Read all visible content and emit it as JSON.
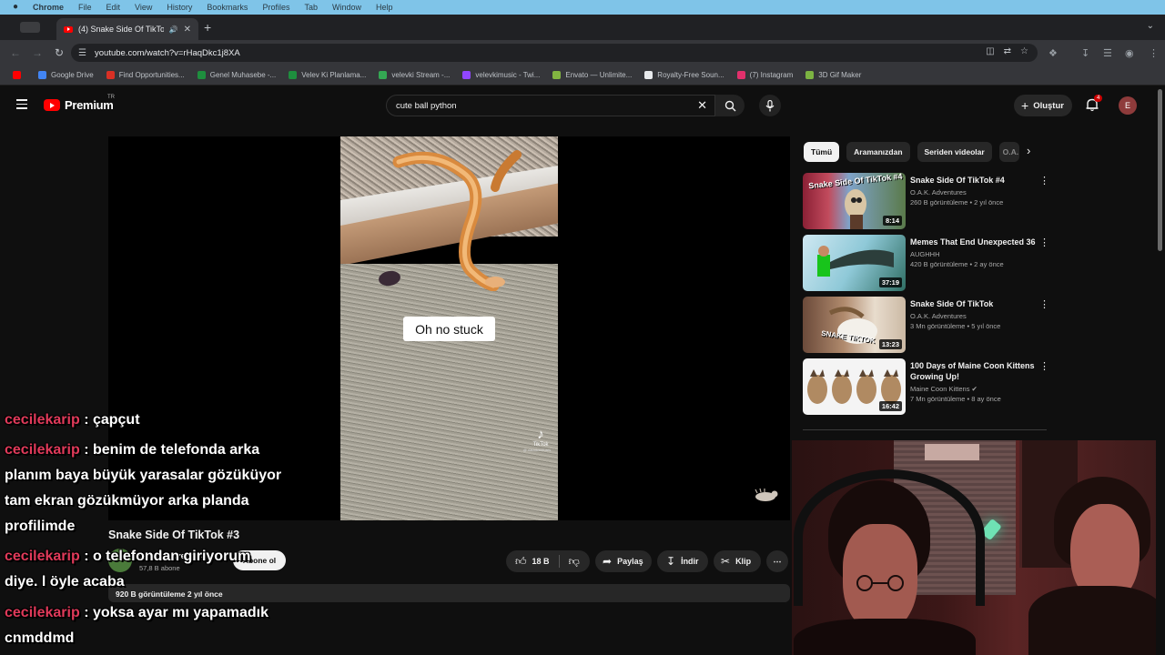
{
  "os_menubar": {
    "items": [
      "Chrome",
      "File",
      "Edit",
      "View",
      "History",
      "Bookmarks",
      "Profiles",
      "Tab",
      "Window",
      "Help"
    ]
  },
  "browser": {
    "tab_title": "(4) Snake Side Of TikTok",
    "url": "youtube.com/watch?v=rHaqDkc1j8XA",
    "bookmarks": [
      {
        "label": "Google Drive",
        "color": "#4285f4"
      },
      {
        "label": "Find Opportunities...",
        "color": "#d93025"
      },
      {
        "label": "Genel Muhasebe -...",
        "color": "#1e8e3e"
      },
      {
        "label": "Velev Ki Planlama...",
        "color": "#1e8e3e"
      },
      {
        "label": "velevki Stream -...",
        "color": "#34a853"
      },
      {
        "label": "velevkimusic - Twi...",
        "color": "#9146ff"
      },
      {
        "label": "Envato — Unlimite...",
        "color": "#82b541"
      },
      {
        "label": "Royalty-Free Soun...",
        "color": "#e8eaed"
      },
      {
        "label": "(7) Instagram",
        "color": "#e1306c"
      },
      {
        "label": "3D Gif Maker",
        "color": "#7cb342"
      }
    ]
  },
  "youtube": {
    "logo_text": "Premium",
    "region": "TR",
    "search_value": "cute ball python",
    "create_label": "Oluştur",
    "notifications_count": "4",
    "avatar_letter": "E",
    "video": {
      "caption": "Oh no stuck",
      "tiktok_label": "TikTok",
      "tiktok_user": "@.oatadventures",
      "title": "Snake Side Of TikTok #3",
      "channel": "O.A.K. Adventures",
      "subscribers": "57,8 B abone",
      "subscribe_label": "Abone ol",
      "likes": "18 B",
      "share_label": "Paylaş",
      "download_label": "İndir",
      "clip_label": "Klip",
      "views_and_date": "920 B görüntüleme  2 yıl önce"
    },
    "chips": [
      "Tümü",
      "Aramanızdan",
      "Seriden videolar",
      "O.A."
    ],
    "recommendations": [
      {
        "title": "Snake Side Of TikTok #4",
        "channel": "O.A.K. Adventures",
        "meta": "260 B görüntüleme • 2 yıl önce",
        "duration": "8:14"
      },
      {
        "title": "Memes That End Unexpected 36",
        "channel": "AUGHHH",
        "meta": "420 B görüntüleme • 2 ay önce",
        "duration": "37:19"
      },
      {
        "title": "Snake Side Of TikTok",
        "channel": "O.A.K. Adventures",
        "meta": "3 Mn görüntüleme • 5 yıl önce",
        "duration": "13:23"
      },
      {
        "title": "100 Days of Maine Coon Kittens Growing Up!",
        "channel": "Maine Coon Kittens",
        "meta": "7 Mn görüntüleme • 8 ay önce",
        "duration": "16:42"
      }
    ],
    "thumb_texts": {
      "snake4": "Snake Side Of TikTok #4",
      "snake": "SNAKE TIKTOK"
    }
  },
  "chat": [
    {
      "user": "cecilekarip",
      "text": ": çapçut"
    },
    {
      "user": "cecilekarip",
      "text": ": benim de telefonda arka"
    },
    {
      "user": "",
      "text": "planım baya büyük yarasalar gözüküyor"
    },
    {
      "user": "",
      "text": "tam ekran gözükmüyor arka planda"
    },
    {
      "user": "",
      "text": "profilimde"
    },
    {
      "user": "cecilekarip",
      "text": ": o telefondan giriyorum"
    },
    {
      "user": "",
      "text": "diye. l öyle acaba"
    },
    {
      "user": "cecilekarip",
      "text": ": yoksa ayar mı yapamadık"
    },
    {
      "user": "",
      "text": "cnmddmd"
    }
  ],
  "colors": {
    "accent_red": "#ff0000",
    "chat_user": "#e03a5a",
    "bg": "#0f0f0f"
  }
}
